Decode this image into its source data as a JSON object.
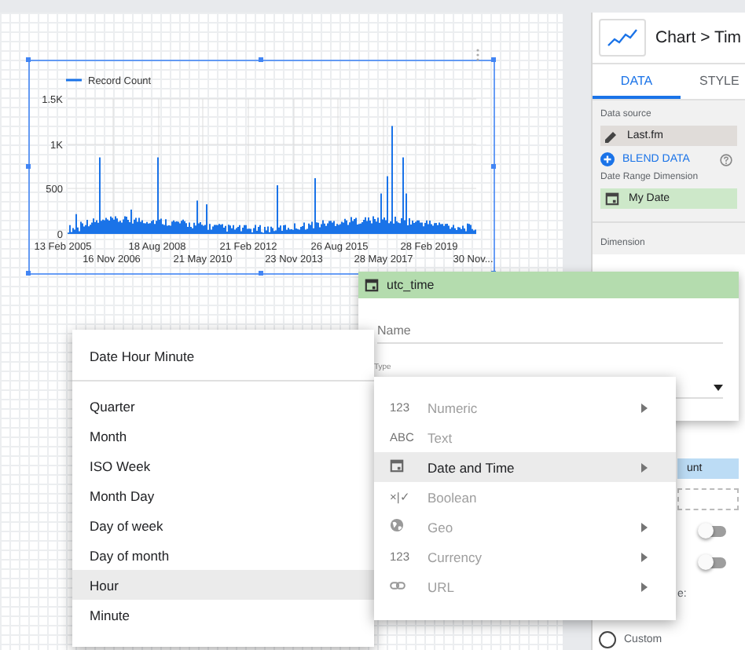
{
  "chart": {
    "legend": "Record Count",
    "y_ticks": [
      "1.5K",
      "1K",
      "500",
      "0"
    ],
    "x_ticks_top": [
      "13 Feb 2005",
      "18 Aug 2008",
      "21 Feb 2012",
      "26 Aug 2015",
      "28 Feb 2019"
    ],
    "x_ticks_bottom": [
      "16 Nov 2006",
      "21 May 2010",
      "23 Nov 2013",
      "28 May 2017",
      "30 Nov..."
    ]
  },
  "panel": {
    "title": "Chart > Tim",
    "tabs": [
      {
        "label": "DATA",
        "selected": true
      },
      {
        "label": "STYLE",
        "selected": false
      }
    ],
    "data_source_label": "Data source",
    "data_source": "Last.fm",
    "blend_button": "BLEND DATA",
    "date_range_label": "Date Range Dimension",
    "date_range_value": "My Date",
    "dimension_label": "Dimension",
    "metric_chip": "unt",
    "toggles": [
      {
        "on": false
      },
      {
        "on": false
      }
    ],
    "cut_label": "e:",
    "radio": {
      "label": "Custom",
      "selected": false
    }
  },
  "field_editor": {
    "title": "utc_time",
    "name_placeholder": "Name",
    "type_label": "Type"
  },
  "type_menu": [
    {
      "kind": "text",
      "icon_text": "123",
      "label": "Numeric",
      "disabled": true,
      "selected": false,
      "submenu": true
    },
    {
      "kind": "text",
      "icon_text": "ABC",
      "label": "Text",
      "disabled": true,
      "selected": false,
      "submenu": false
    },
    {
      "kind": "calendar",
      "label": "Date and Time",
      "disabled": false,
      "selected": true,
      "submenu": true
    },
    {
      "kind": "text",
      "icon_text": "×|✓",
      "label": "Boolean",
      "disabled": true,
      "selected": false,
      "submenu": false
    },
    {
      "kind": "globe",
      "label": "Geo",
      "disabled": true,
      "selected": false,
      "submenu": true
    },
    {
      "kind": "text",
      "icon_text": "123",
      "label": "Currency",
      "disabled": true,
      "selected": false,
      "submenu": true
    },
    {
      "kind": "link",
      "label": "URL",
      "disabled": true,
      "selected": false,
      "submenu": true
    }
  ],
  "granularity_menu": {
    "header": "Date Hour Minute",
    "items": [
      {
        "label": "Quarter",
        "selected": false
      },
      {
        "label": "Month",
        "selected": false
      },
      {
        "label": "ISO Week",
        "selected": false
      },
      {
        "label": "Month Day",
        "selected": false
      },
      {
        "label": "Day of week",
        "selected": false
      },
      {
        "label": "Day of month",
        "selected": false
      },
      {
        "label": "Hour",
        "selected": true
      },
      {
        "label": "Minute",
        "selected": false
      }
    ]
  }
}
